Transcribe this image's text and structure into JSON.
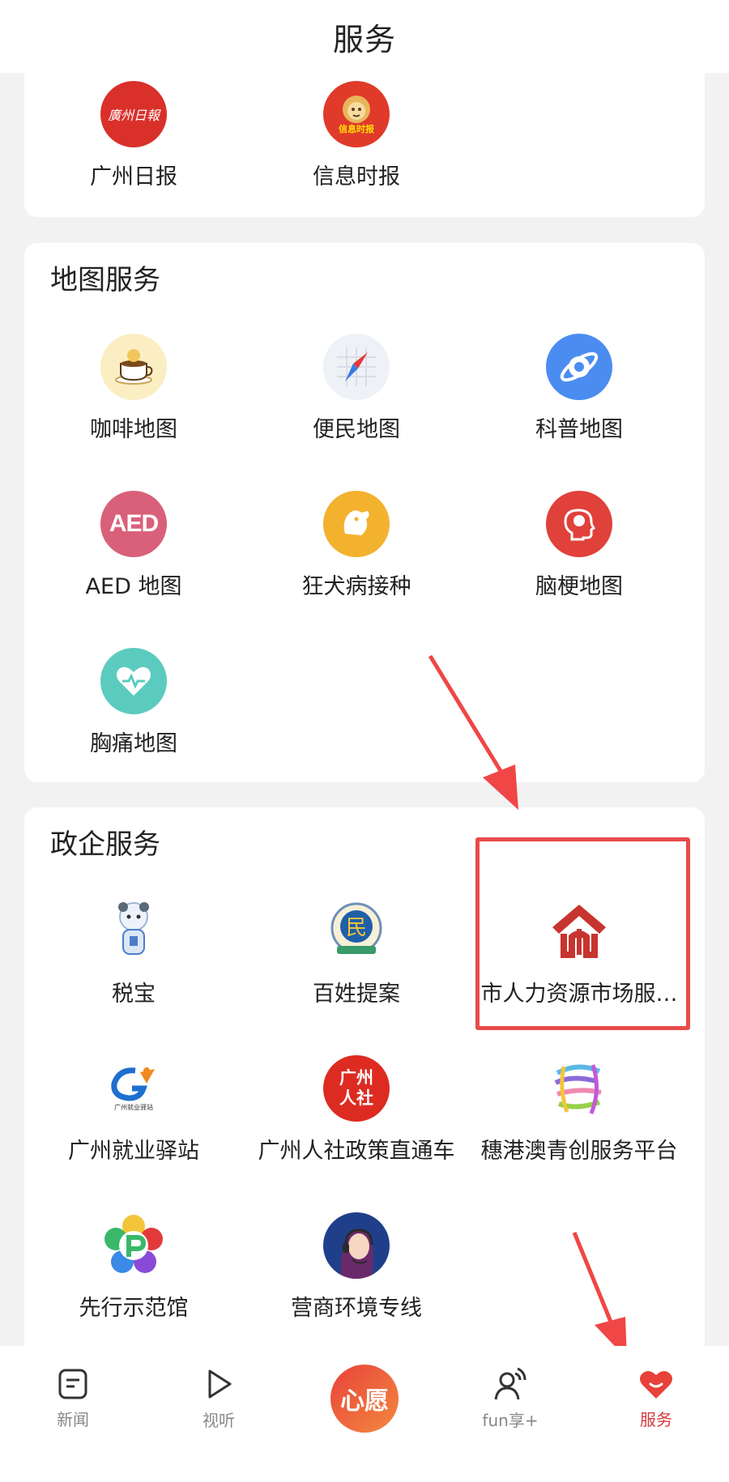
{
  "header": {
    "title": "服务"
  },
  "media": {
    "items": [
      {
        "label": "广州日报",
        "icon": "guangzhou-daily-logo",
        "logo_text": "廣州日報"
      },
      {
        "label": "信息时报",
        "icon": "xinxi-times-logo",
        "logo_text": "信息时报"
      }
    ]
  },
  "map_services": {
    "title": "地图服务",
    "items": [
      {
        "label": "咖啡地图",
        "icon": "coffee-cup-icon"
      },
      {
        "label": "便民地图",
        "icon": "compass-icon"
      },
      {
        "label": "科普地图",
        "icon": "planet-icon"
      },
      {
        "label": "AED 地图",
        "icon": "aed-icon",
        "badge_text": "AED"
      },
      {
        "label": "狂犬病接种",
        "icon": "dog-icon"
      },
      {
        "label": "脑梗地图",
        "icon": "brain-head-icon"
      },
      {
        "label": "胸痛地图",
        "icon": "heart-pulse-icon"
      }
    ]
  },
  "gov_services": {
    "title": "政企服务",
    "items": [
      {
        "label": "税宝",
        "icon": "tax-mascot-icon"
      },
      {
        "label": "百姓提案",
        "icon": "people-proposal-badge-icon",
        "badge_text": "民"
      },
      {
        "label": "市人力资源市场服…",
        "icon": "hr-market-house-icon"
      },
      {
        "label": "广州就业驿站",
        "icon": "employment-station-logo",
        "logo_text": "广州就业驿站"
      },
      {
        "label": "广州人社政策直通车",
        "icon": "gz-hrss-logo",
        "logo_text": "广州人社"
      },
      {
        "label": "穗港澳青创服务平台",
        "icon": "ribbon-logo-icon"
      },
      {
        "label": "先行示范馆",
        "icon": "star-flower-icon"
      },
      {
        "label": "营商环境专线",
        "icon": "headset-agent-icon"
      }
    ]
  },
  "bottom_nav": {
    "items": [
      {
        "label": "新闻",
        "icon": "news-doc-icon",
        "active": false
      },
      {
        "label": "视听",
        "icon": "play-icon",
        "active": false
      },
      {
        "label": "心愿",
        "icon": "wish-center-button",
        "active": false
      },
      {
        "label": "fun享+",
        "icon": "person-signal-icon",
        "active": false
      },
      {
        "label": "服务",
        "icon": "heart-smile-icon",
        "active": true
      }
    ]
  },
  "colors": {
    "accent_red": "#e94b4b",
    "active_nav": "#d63a3a",
    "wish_gradient": [
      "#ea4b3c",
      "#f2853f"
    ]
  }
}
